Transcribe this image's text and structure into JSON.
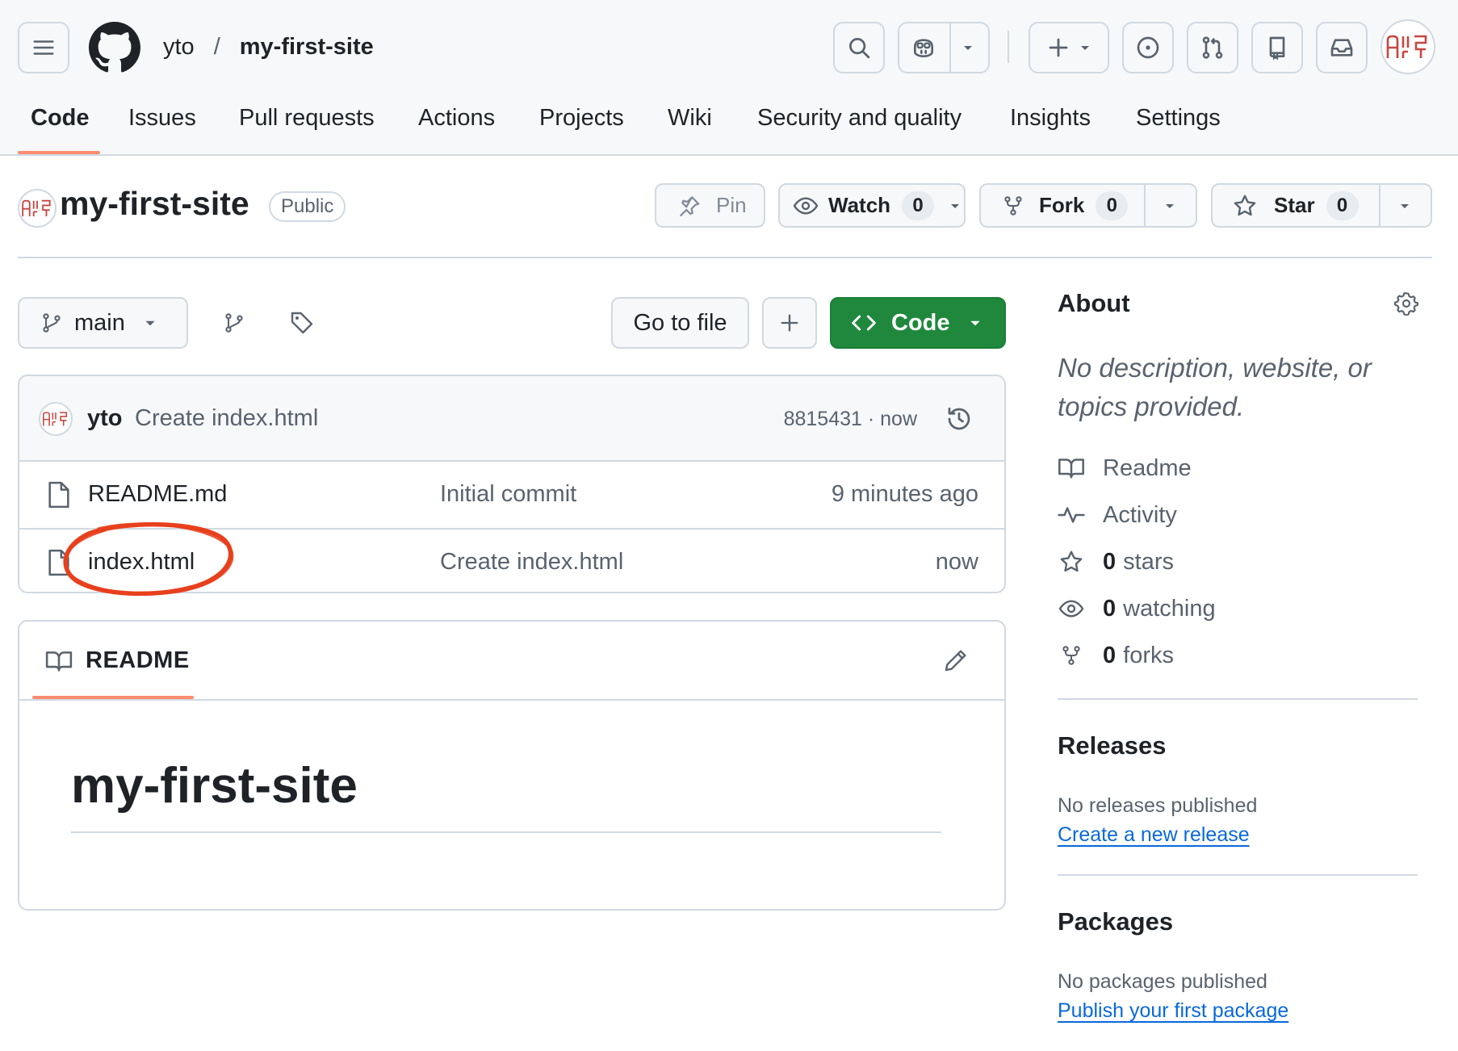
{
  "header": {
    "owner": "yto",
    "separator": "/",
    "repo": "my-first-site",
    "tabs": [
      {
        "label": "Code"
      },
      {
        "label": "Issues"
      },
      {
        "label": "Pull requests"
      },
      {
        "label": "Actions"
      },
      {
        "label": "Projects"
      },
      {
        "label": "Wiki"
      },
      {
        "label": "Security and quality"
      },
      {
        "label": "Insights"
      },
      {
        "label": "Settings"
      }
    ],
    "active_tab": "Code",
    "avatar_text": "ᗅ‖ᖷ"
  },
  "repo_header": {
    "title": "my-first-site",
    "visibility": "Public",
    "pin_label": "Pin",
    "watch_label": "Watch",
    "watch_count": "0",
    "fork_label": "Fork",
    "fork_count": "0",
    "star_label": "Star",
    "star_count": "0"
  },
  "toolbar": {
    "branch": "main",
    "go_to_file": "Go to file",
    "code_label": "Code"
  },
  "latest_commit": {
    "author": "yto",
    "message": "Create index.html",
    "sha_time": "8815431 · now"
  },
  "files": [
    {
      "name": "README.md",
      "message": "Initial commit",
      "time": "9 minutes ago"
    },
    {
      "name": "index.html",
      "message": "Create index.html",
      "time": "now"
    }
  ],
  "readme": {
    "tab_label": "README",
    "heading": "my-first-site"
  },
  "about": {
    "title": "About",
    "description": "No description, website, or topics provided.",
    "readme": "Readme",
    "activity": "Activity",
    "stars_count": "0",
    "stars_label": "stars",
    "watching_count": "0",
    "watching_label": "watching",
    "forks_count": "0",
    "forks_label": "forks"
  },
  "releases": {
    "title": "Releases",
    "empty": "No releases published",
    "link": "Create a new release"
  },
  "packages": {
    "title": "Packages",
    "empty": "No packages published",
    "link": "Publish your first package"
  },
  "annotation": {
    "color": "#e8401c",
    "highlighted_item": "index.html"
  },
  "colors": {
    "accent_underline": "#fd8c73",
    "code_button": "#1f883d",
    "link": "#0969da"
  }
}
